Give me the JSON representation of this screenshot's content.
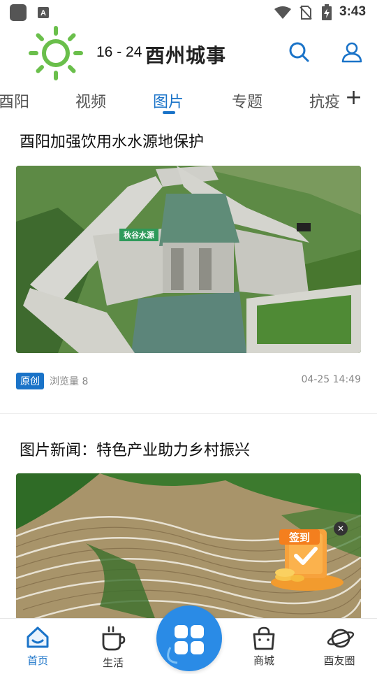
{
  "status_bar": {
    "time": "3:43"
  },
  "header": {
    "weather_temp": "16 - 24",
    "app_name": "酉州城事"
  },
  "tabs": [
    {
      "label": "酉阳"
    },
    {
      "label": "视频"
    },
    {
      "label": "图片",
      "active": true
    },
    {
      "label": "专题"
    },
    {
      "label": "抗疫"
    }
  ],
  "articles": [
    {
      "title": "酉阳加强饮用水水源地保护",
      "sign_text": "秋谷水源",
      "badge": "原创",
      "views": "浏览量 8",
      "date": "04-25 14:49"
    },
    {
      "title": "图片新闻：特色产业助力乡村振兴"
    }
  ],
  "signin": {
    "label": "签到"
  },
  "bottom_nav": [
    {
      "label": "首页",
      "icon": "home-icon",
      "active": true
    },
    {
      "label": "生活",
      "icon": "coffee-cup-icon"
    },
    {
      "label": "商城",
      "icon": "shopping-bag-icon"
    },
    {
      "label": "酉友圈",
      "icon": "planet-icon"
    }
  ],
  "colors": {
    "accent": "#1a73c8",
    "sun": "#6abf4b",
    "center_button": "#2a8be6"
  }
}
